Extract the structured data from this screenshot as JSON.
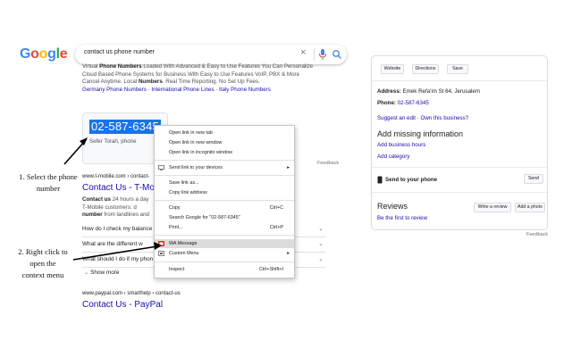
{
  "search": {
    "query": "contact us phone number",
    "clear_glyph": "×",
    "logo_letters": [
      "G",
      "o",
      "o",
      "g",
      "l",
      "e"
    ]
  },
  "colors": {
    "blue": "#4285F4",
    "red": "#EA4335",
    "yellow": "#FBBC05",
    "green": "#34A853",
    "link": "#1a0dab",
    "selection": "#1a73e8"
  },
  "ad": {
    "line1_prefix": "Virtual ",
    "line1_bold": "Phone Numbers",
    "line1_rest": " Loaded With Advanced & Easy to Use Features You Can Personalize",
    "line2": "Cloud Based Phone Systems for Business With Easy to Use Features VoIP, PBX & More",
    "line3_prefix": "Cancel Anytime. Local ",
    "line3_bold": "Numbers",
    "line3_rest": ". Real Time Reporting. No Set Up Fees.",
    "sitelinks": "Germany Phone Numbers · International Phone Lines · Italy Phone Numbers"
  },
  "featured": {
    "number": "02-587-6345",
    "subtitle": "Sefer Torah, phone",
    "feedback": "Feedback"
  },
  "result1": {
    "url": "www.t-mobile.com › contact-",
    "title": "Contact Us - T-Mobil",
    "snippet1_bold": "Contact us",
    "snippet1_rest": " 24 hours a day",
    "snippet2_prefix": "T-Mobile customers: d",
    "snippet3_bold": "number",
    "snippet3_rest": " from landlines and"
  },
  "faqs": [
    {
      "q": "How do I check my balance"
    },
    {
      "q": "What are the different w"
    },
    {
      "q": "What should I do if my phon"
    }
  ],
  "show_more": "Show more",
  "result2": {
    "url": "www.paypal.com › smarthelp › contact-us",
    "title": "Contact Us - PayPal"
  },
  "context_menu": {
    "items": [
      {
        "label": "Open link in new tab"
      },
      {
        "label": "Open link in new window"
      },
      {
        "label": "Open link in incognito window"
      },
      {
        "label": "Send link to your devices"
      },
      {
        "label": "Save link as..."
      },
      {
        "label": "Copy link address"
      },
      {
        "label": "Copy",
        "shortcut": "Ctrl+C"
      },
      {
        "label": "Search Google for \"02-587-6345\""
      },
      {
        "label": "Print...",
        "shortcut": "Ctrl+P"
      },
      {
        "label": "WA Message"
      },
      {
        "label": "Custom Menu"
      },
      {
        "label": "Inspect",
        "shortcut": "Ctrl+Shift+I"
      }
    ]
  },
  "knowledge_panel": {
    "buttons": [
      "Website",
      "Directions",
      "Save"
    ],
    "address_label": "Address:",
    "address_value": " Emek Refa'im St 64, Jerusalem",
    "phone_label": "Phone:",
    "phone_value": " 02-587-6345",
    "suggest_edit": "Suggest an edit · Own this business?",
    "missing_heading": "Add missing information",
    "add_hours": "Add business hours",
    "add_category": "Add category",
    "send_phone_label": "Send to your phone",
    "send_button": "Send",
    "reviews_heading": "Reviews",
    "write_review": "Write a review",
    "add_photo": "Add a photo",
    "first_review": "Be the first to review",
    "feedback": "Feedback"
  },
  "annotations": {
    "step1": "1. Select the phone\nnumber",
    "step2": "2. Right click to\nopen the\ncontext menu"
  }
}
